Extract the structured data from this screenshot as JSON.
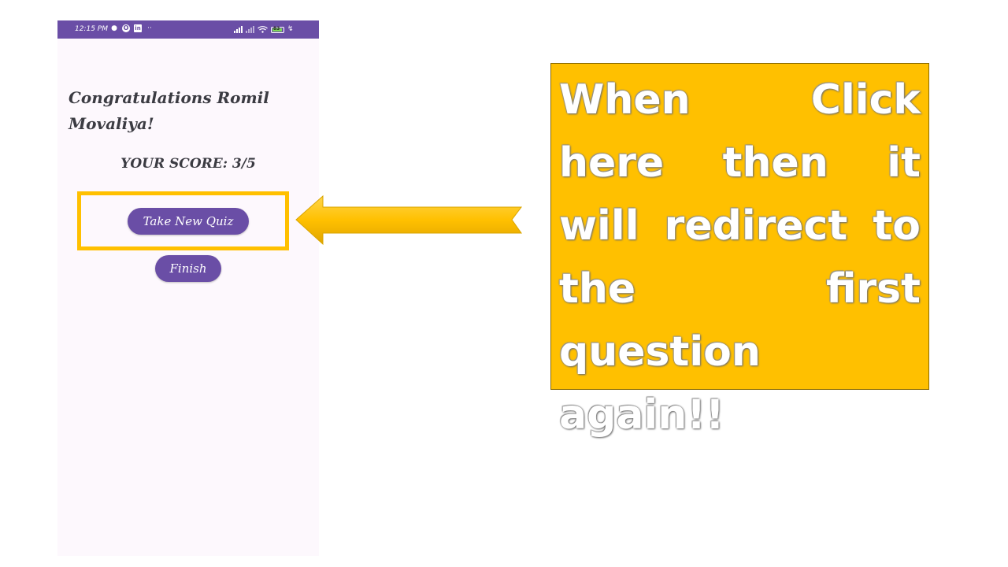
{
  "status_bar": {
    "time": "12:15 PM",
    "left_icons": [
      "chat-bubble-icon",
      "opera-icon",
      "linkedin-icon",
      "more-dots-icon"
    ],
    "right_icons": [
      "signal-icon",
      "signal-weak-icon",
      "wifi-icon",
      "battery-icon",
      "charging-bolt-icon"
    ],
    "battery_level": "83"
  },
  "screen": {
    "congrats_text": "Congratulations Romil Movaliya!",
    "score_text": "YOUR SCORE: 3/5",
    "take_new_quiz_label": "Take New Quiz",
    "finish_label": "Finish"
  },
  "callout": {
    "text": "When Click here then it will redirect to the first question again!!"
  },
  "colors": {
    "primary": "#6a4ea6",
    "highlight": "#ffc000",
    "screen_bg": "#fdf8fd",
    "text": "#3b3b42"
  }
}
